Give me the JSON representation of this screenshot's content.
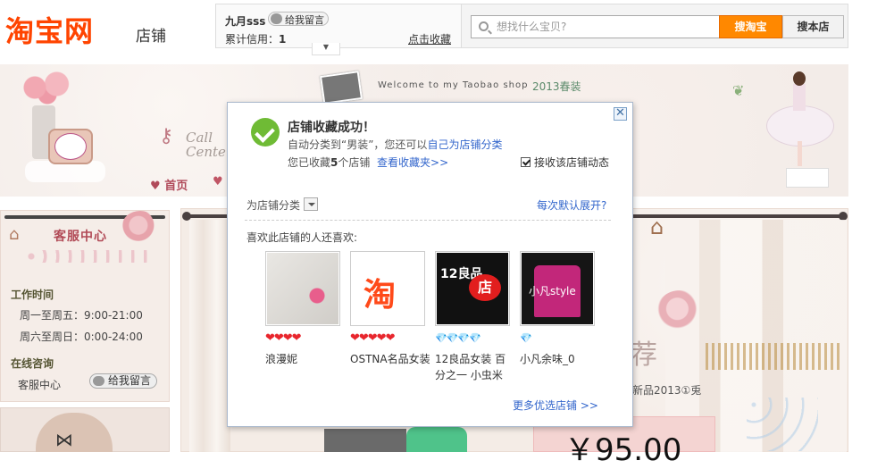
{
  "header": {
    "logo_text": "淘宝网",
    "logo_sub": "店铺",
    "shop_name": "九月sss",
    "leave_msg_label": "给我留言",
    "credit_label": "累计信用：",
    "credit_value": "1",
    "favorite_link": "点击收藏",
    "search_placeholder": "想找什么宝贝?",
    "search_taobao_button": "搜淘宝",
    "search_shop_button": "搜本店"
  },
  "banner": {
    "welcome_text": "Welcome to my Taobao shop",
    "season_text": "2013春装",
    "call_center_text": "Call Center",
    "nav_home": "首页"
  },
  "sidebar": {
    "service_title": "客服中心",
    "work_time_title": "工作时间",
    "work_rows": [
      "周一至周五：9:00-21:00",
      "周六至周日：0:00-24:00"
    ],
    "online_title": "在线咨询",
    "service_agent": "客服中心",
    "leave_msg_label": "给我留言"
  },
  "main": {
    "rec_char": "荐",
    "new_text": "新品2013①兎",
    "price": "￥95.00"
  },
  "popup": {
    "title": "店铺收藏成功！",
    "line1_prefix": "自动分类到“男装”，您还可以",
    "line1_link": "自己为店铺分类",
    "line2_prefix": "您已收藏",
    "line2_count": "5",
    "line2_suffix": "个店铺",
    "line2_link": "查看收藏夹>>",
    "receive_checkbox_label": "接收该店铺动态",
    "receive_checked": true,
    "category_label": "为店铺分类",
    "expand_link": "每次默认展开?",
    "like_title": "喜欢此店铺的人还喜欢:",
    "shops": [
      {
        "name": "浪漫妮",
        "rating_type": "heart",
        "rating_count": 4,
        "rating_glyphs": "❤❤❤❤"
      },
      {
        "name": "OSTNA名品女装",
        "rating_type": "heart",
        "rating_count": 5,
        "rating_glyphs": "❤❤❤❤❤"
      },
      {
        "name": "12良品女装 百分之一 小虫米",
        "rating_type": "diamond",
        "rating_count": 4,
        "rating_glyphs": "💎💎💎💎"
      },
      {
        "name": "小凡余味_0",
        "rating_type": "diamond",
        "rating_count": 1,
        "rating_glyphs": "💎"
      }
    ],
    "shop_thumbs": {
      "t2_char": "淘",
      "t3_text": "12良品",
      "t3_badge": "店",
      "t4_text": "小凡style"
    },
    "more_link": "更多优选店铺 >>"
  },
  "colors": {
    "brand_orange": "#ff4400",
    "search_button": "#ff8800",
    "link_blue": "#3366cc",
    "heart_red": "#e8262d",
    "diamond_blue": "#3fa9d8",
    "success_green": "#6fbb35"
  }
}
